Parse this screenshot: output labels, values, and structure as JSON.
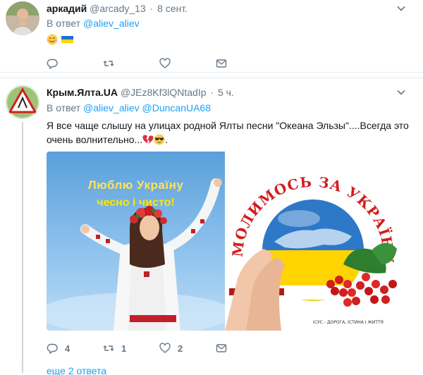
{
  "tweets": [
    {
      "name": "аркадий",
      "handle": "@arcady_13",
      "time": "8 сент.",
      "reply_label": "В ответ",
      "reply_to": [
        "@aliev_aliev"
      ],
      "text": "",
      "emojis": [
        "smiling-face-emoji",
        "ukraine-flag-emoji"
      ],
      "actions": {
        "reply": "",
        "retweet": "",
        "like": ""
      }
    },
    {
      "name": "Крым.Ялта.UA",
      "handle": "@JEz8Kf3lQNtadIp",
      "time": "5 ч.",
      "reply_label": "В ответ",
      "reply_to": [
        "@aliev_aliev",
        "@DuncanUA68"
      ],
      "text": "Я все чаще слышу на улицах родной Ялты песни \"Океана Эльзы\"....Всегда это очень волнительно...",
      "emojis": [
        "broken-heart-emoji",
        "smiling-face-with-sunglasses-emoji"
      ],
      "text_tail": ".",
      "media": [
        {
          "line1": "Люблю Україну",
          "line2": "чесно і чисто!"
        },
        {
          "arc_text": "МОЛИМОСЬ ЗА УКРАЇНУ",
          "bottom_text": "ІСУС - ДОРОГА, ІСТИНА І ЖИТТЯ"
        }
      ],
      "actions": {
        "reply": "4",
        "retweet": "1",
        "like": "2"
      }
    }
  ],
  "more_replies": "еще 2 ответа",
  "colors": {
    "link": "#1da1f2",
    "muted": "#657786",
    "border": "#e6ecf0"
  }
}
